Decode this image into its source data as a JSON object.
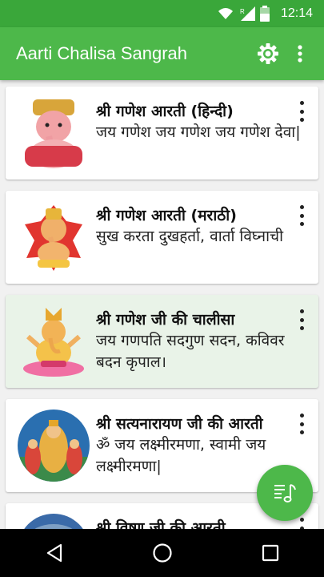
{
  "status_bar": {
    "time": "12:14",
    "network_label": "R"
  },
  "app_bar": {
    "title": "Aarti Chalisa Sangrah"
  },
  "cards": [
    {
      "title": "श्री गणेश आरती (हिन्दी)",
      "description": "जय गणेश जय गणेश जय गणेश देवा|"
    },
    {
      "title": "श्री गणेश आरती (मराठी)",
      "description": "सुख करता दुखहर्ता, वार्ता विघ्नाची"
    },
    {
      "title": "श्री गणेश जी की चालीसा",
      "description": "जय गणपति सदगुण सदन, कविवर बदन कृपाल।"
    },
    {
      "title": "श्री सत्यनारायण जी की आरती",
      "description": "ॐ जय लक्ष्मीरमणा, स्वामी जय लक्ष्मीरमणा|"
    },
    {
      "title": "श्री विष्णु जी की आरती",
      "description": ""
    }
  ],
  "colors": {
    "primary": "#4db84a",
    "status": "#3aa73a",
    "selected_card": "#e9f3e8"
  },
  "icons": {
    "settings": "gear-icon",
    "overflow": "more-vert-icon",
    "fab": "playlist-music-icon"
  }
}
